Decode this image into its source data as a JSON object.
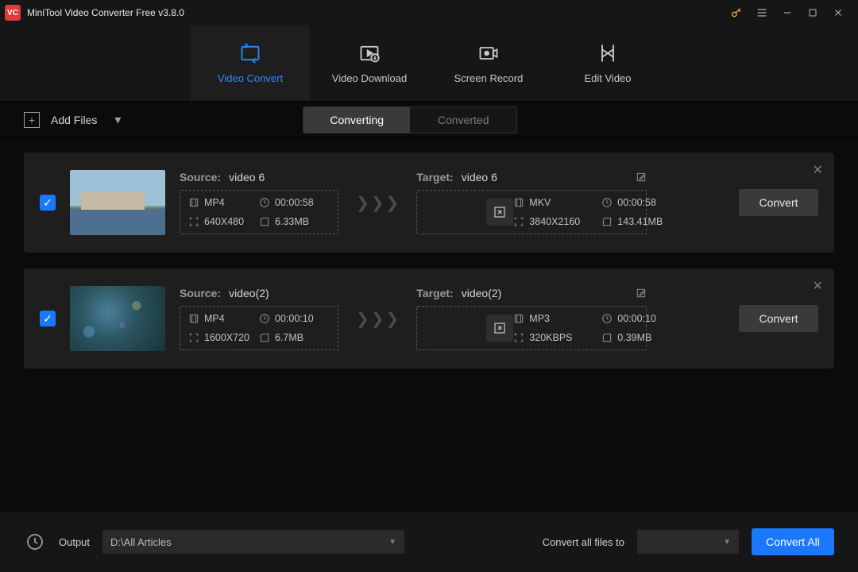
{
  "titlebar": {
    "title": "MiniTool Video Converter Free v3.8.0"
  },
  "nav": {
    "convert": "Video Convert",
    "download": "Video Download",
    "record": "Screen Record",
    "edit": "Edit Video"
  },
  "subbar": {
    "add_files": "Add Files",
    "tab_converting": "Converting",
    "tab_converted": "Converted"
  },
  "tasks": [
    {
      "source_label": "Source:",
      "source_name": "video 6",
      "src_format": "MP4",
      "src_duration": "00:00:58",
      "src_resolution": "640X480",
      "src_size": "6.33MB",
      "target_label": "Target:",
      "target_name": "video 6",
      "tgt_format": "MKV",
      "tgt_duration": "00:00:58",
      "tgt_resolution": "3840X2160",
      "tgt_size": "143.41MB",
      "convert_label": "Convert"
    },
    {
      "source_label": "Source:",
      "source_name": "video(2)",
      "src_format": "MP4",
      "src_duration": "00:00:10",
      "src_resolution": "1600X720",
      "src_size": "6.7MB",
      "target_label": "Target:",
      "target_name": "video(2)",
      "tgt_format": "MP3",
      "tgt_duration": "00:00:10",
      "tgt_resolution": "320KBPS",
      "tgt_size": "0.39MB",
      "convert_label": "Convert"
    }
  ],
  "footer": {
    "output_label": "Output",
    "output_path": "D:\\All Articles",
    "convert_all_to_label": "Convert all files to",
    "convert_all_btn": "Convert All"
  }
}
